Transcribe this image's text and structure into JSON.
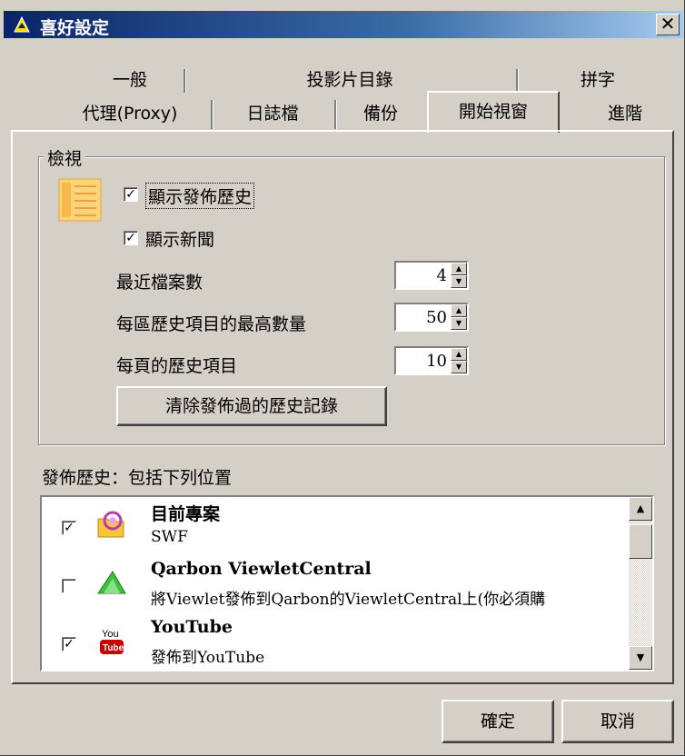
{
  "window": {
    "title": "喜好設定",
    "close_label": "✕"
  },
  "tabs": {
    "row_back": [
      "一般",
      "投影片目錄",
      "拼字"
    ],
    "row_front": [
      "代理(Proxy)",
      "日誌檔",
      "備份",
      "開始視窗",
      "進階"
    ],
    "active": "開始視窗"
  },
  "view_group": {
    "label": "檢視",
    "show_publish_history": {
      "label": "顯示發佈歷史",
      "checked": true
    },
    "show_news": {
      "label": "顯示新聞",
      "checked": true
    },
    "recent_files": {
      "label": "最近檔案數",
      "value": "4"
    },
    "max_history_per_area": {
      "label": "每區歷史項目的最高數量",
      "value": "50"
    },
    "history_per_page": {
      "label": "每頁的歷史項目",
      "value": "10"
    },
    "clear_button": "清除發佈過的歷史記錄"
  },
  "publish_history": {
    "label": "發佈歷史：包括下列位置",
    "items": [
      {
        "name": "目前專案",
        "desc": "SWF",
        "checked": true,
        "icon": "folder-icon"
      },
      {
        "name": "Qarbon ViewletCentral",
        "desc": "將Viewlet發佈到Qarbon的ViewletCentral上(你必須購",
        "checked": false,
        "icon": "green-arrow-icon"
      },
      {
        "name": "YouTube",
        "desc": "發佈到YouTube",
        "checked": true,
        "icon": "youtube-icon"
      }
    ]
  },
  "buttons": {
    "ok": "確定",
    "cancel": "取消"
  },
  "colors": {
    "titlebar_start": "#0a246a",
    "face": "#d4d0c8"
  }
}
